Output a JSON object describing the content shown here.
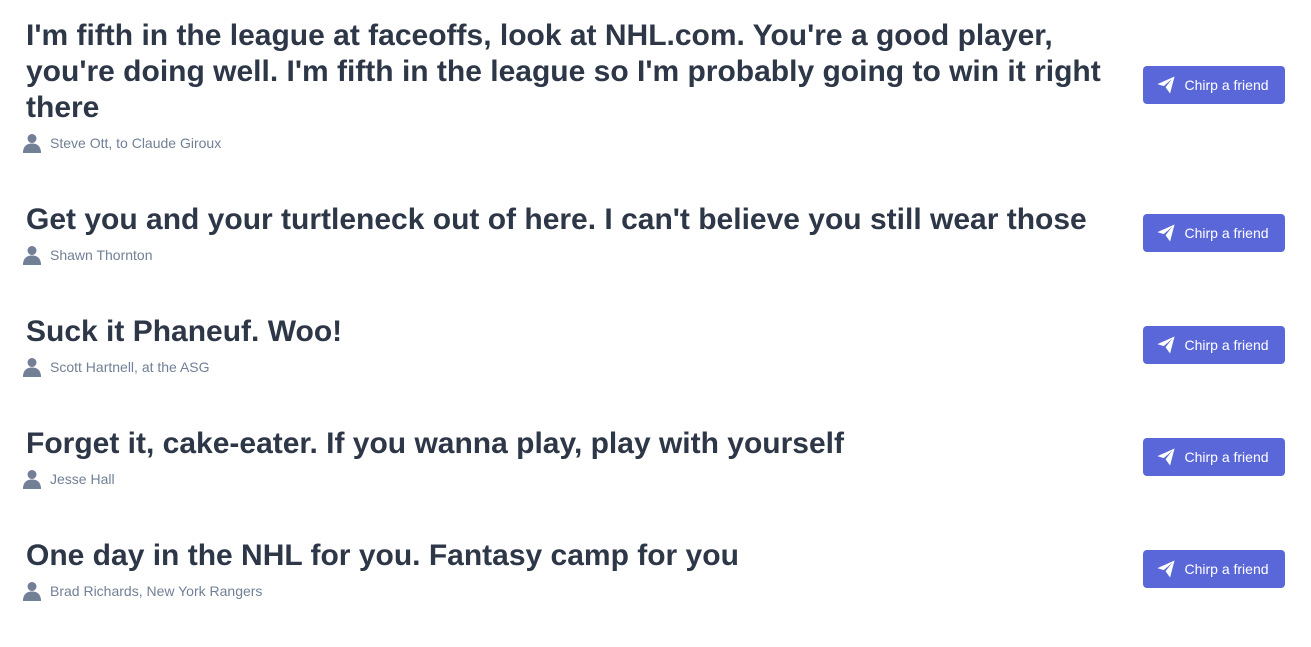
{
  "colors": {
    "quote_text": "#2d3748",
    "author_text": "#718096",
    "button_bg": "#5a67d8",
    "button_text": "#ffffff",
    "user_icon": "#718096"
  },
  "icons": {
    "author": "user-silhouette-icon",
    "button": "paper-plane-icon"
  },
  "chirps": [
    {
      "quote": "I'm fifth in the league at faceoffs, look at NHL.com. You're a good player, you're doing well. I'm fifth in the league so I'm probably going to win it right there",
      "author": "Steve Ott, to Claude Giroux",
      "button_label": "Chirp a friend"
    },
    {
      "quote": "Get you and your turtleneck out of here. I can't believe you still wear those",
      "author": "Shawn Thornton",
      "button_label": "Chirp a friend"
    },
    {
      "quote": "Suck it Phaneuf. Woo!",
      "author": "Scott Hartnell, at the ASG",
      "button_label": "Chirp a friend"
    },
    {
      "quote": "Forget it, cake-eater. If you wanna play, play with yourself",
      "author": "Jesse Hall",
      "button_label": "Chirp a friend"
    },
    {
      "quote": "One day in the NHL for you. Fantasy camp for you",
      "author": "Brad Richards, New York Rangers",
      "button_label": "Chirp a friend"
    }
  ]
}
